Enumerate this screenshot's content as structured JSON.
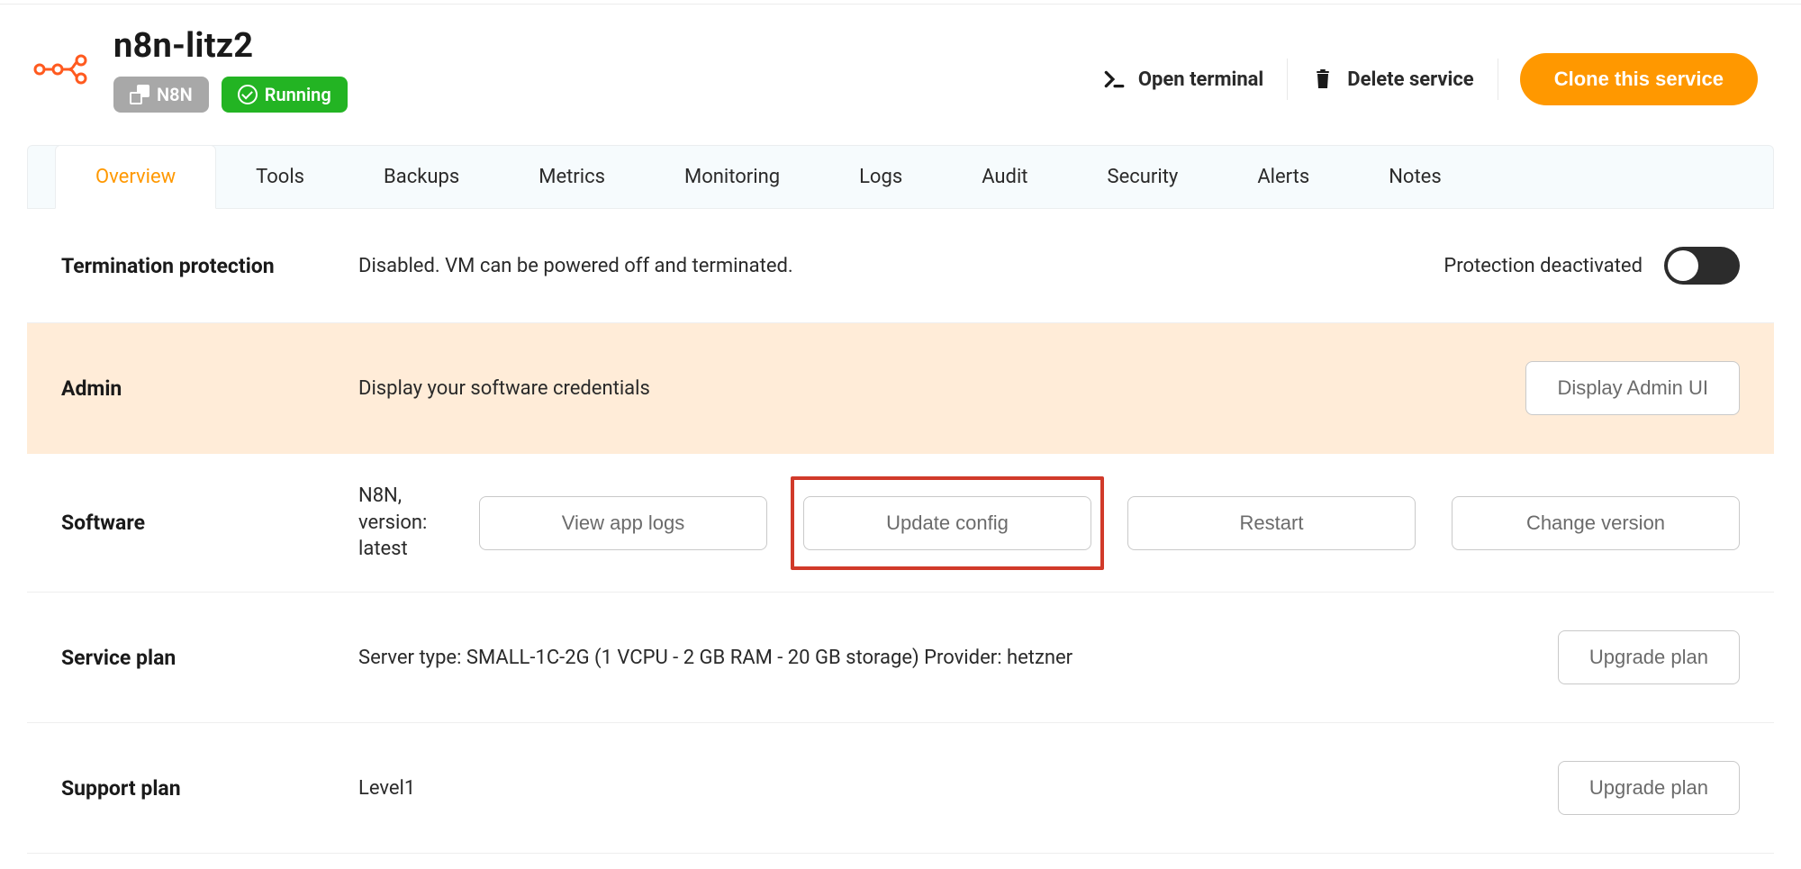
{
  "service": {
    "title": "n8n-litz2",
    "type_badge": "N8N",
    "status_badge": "Running"
  },
  "header_actions": {
    "open_terminal": "Open terminal",
    "delete_service": "Delete service",
    "clone_service": "Clone this service"
  },
  "tabs": {
    "overview": "Overview",
    "tools": "Tools",
    "backups": "Backups",
    "metrics": "Metrics",
    "monitoring": "Monitoring",
    "logs": "Logs",
    "audit": "Audit",
    "security": "Security",
    "alerts": "Alerts",
    "notes": "Notes"
  },
  "rows": {
    "termination": {
      "label": "Termination protection",
      "text": "Disabled. VM can be powered off and terminated.",
      "status": "Protection deactivated"
    },
    "admin": {
      "label": "Admin",
      "text": "Display your software credentials",
      "button": "Display Admin UI"
    },
    "software": {
      "label": "Software",
      "text": "N8N, version: latest",
      "buttons": {
        "view_logs": "View app logs",
        "update_config": "Update config",
        "restart": "Restart",
        "change_version": "Change version"
      }
    },
    "service_plan": {
      "label": "Service plan",
      "text": "Server type: SMALL-1C-2G (1 VCPU - 2 GB RAM - 20 GB storage) Provider: hetzner",
      "button": "Upgrade plan"
    },
    "support_plan": {
      "label": "Support plan",
      "text": "Level1",
      "button": "Upgrade plan"
    }
  }
}
